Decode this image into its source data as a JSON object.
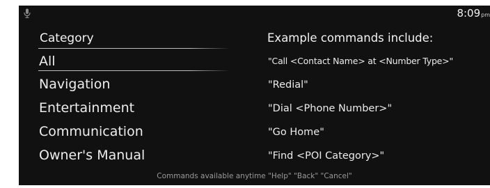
{
  "status_bar": {
    "mic_icon": "microphone-icon",
    "time": "8:09",
    "ampm": "pm"
  },
  "categories": {
    "header": "Category",
    "items": [
      "All",
      "Navigation",
      "Entertainment",
      "Communication",
      "Owner's Manual"
    ],
    "selected": "All"
  },
  "examples": {
    "header": "Example commands include:",
    "items": [
      "\"Call <Contact Name> at <Number Type>\"",
      "\"Redial\"",
      "\"Dial <Phone Number>\"",
      "\"Go Home\"",
      "\"Find <POI Category>\""
    ]
  },
  "footer": {
    "text": "Commands available anytime \"Help\" \"Back\" \"Cancel\""
  },
  "colors": {
    "background": "#111111",
    "text": "#ededed",
    "footer_text": "#9a9a9a",
    "divider": "#dcdcdc"
  }
}
